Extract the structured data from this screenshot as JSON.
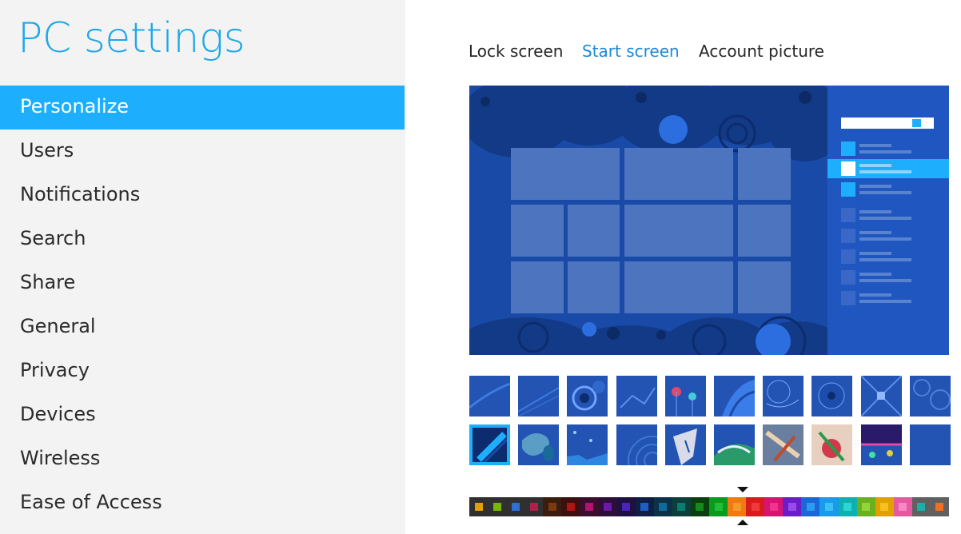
{
  "sidebar": {
    "title": "PC settings",
    "selected_index": 0,
    "items": [
      {
        "label": "Personalize"
      },
      {
        "label": "Users"
      },
      {
        "label": "Notifications"
      },
      {
        "label": "Search"
      },
      {
        "label": "Share"
      },
      {
        "label": "General"
      },
      {
        "label": "Privacy"
      },
      {
        "label": "Devices"
      },
      {
        "label": "Wireless"
      },
      {
        "label": "Ease of Access"
      }
    ]
  },
  "tabs": [
    {
      "label": "Lock screen",
      "active": false
    },
    {
      "label": "Start screen",
      "active": true
    },
    {
      "label": "Account picture",
      "active": false
    }
  ],
  "colors": {
    "accent": "#1eaefe",
    "title": "#1fa7e8",
    "active_tab": "#1b8ad6",
    "background": "#1a4aa8"
  },
  "background_patterns": {
    "selected_index": 10,
    "count": 20
  },
  "color_swatches": {
    "selected_index": 14,
    "items": [
      {
        "bg": "#303030",
        "fg": "#e0a000"
      },
      {
        "bg": "#303030",
        "fg": "#7ab800"
      },
      {
        "bg": "#303030",
        "fg": "#2f6fd6"
      },
      {
        "bg": "#303030",
        "fg": "#b0204a"
      },
      {
        "bg": "#3a1d0c",
        "fg": "#7a3a12"
      },
      {
        "bg": "#3d0f0f",
        "fg": "#b01414"
      },
      {
        "bg": "#3a0e2c",
        "fg": "#b0146e"
      },
      {
        "bg": "#2c0e3a",
        "fg": "#6c18a8"
      },
      {
        "bg": "#1e1040",
        "fg": "#4a24b8"
      },
      {
        "bg": "#0f1f44",
        "fg": "#1e5cc8"
      },
      {
        "bg": "#0d3148",
        "fg": "#0f6c9a"
      },
      {
        "bg": "#0b3f3a",
        "fg": "#0a7c70"
      },
      {
        "bg": "#0a3f10",
        "fg": "#158a1c"
      },
      {
        "bg": "#0a9a1e",
        "fg": "#1ec03a"
      },
      {
        "bg": "#ee7a10",
        "fg": "#f59a2a"
      },
      {
        "bg": "#d61c1c",
        "fg": "#f03a3a"
      },
      {
        "bg": "#d41572",
        "fg": "#f0348e"
      },
      {
        "bg": "#6a1ec6",
        "fg": "#9a4ae8"
      },
      {
        "bg": "#1a68d6",
        "fg": "#2e9af0"
      },
      {
        "bg": "#1a9ae8",
        "fg": "#3cc0f5"
      },
      {
        "bg": "#0fb0b0",
        "fg": "#2cd6d6"
      },
      {
        "bg": "#6ab020",
        "fg": "#90d63a"
      },
      {
        "bg": "#e0a000",
        "fg": "#f5c020"
      },
      {
        "bg": "#e35aa0",
        "fg": "#f888c8"
      },
      {
        "bg": "#606060",
        "fg": "#1ab0a8"
      },
      {
        "bg": "#606060",
        "fg": "#f07020"
      }
    ]
  }
}
